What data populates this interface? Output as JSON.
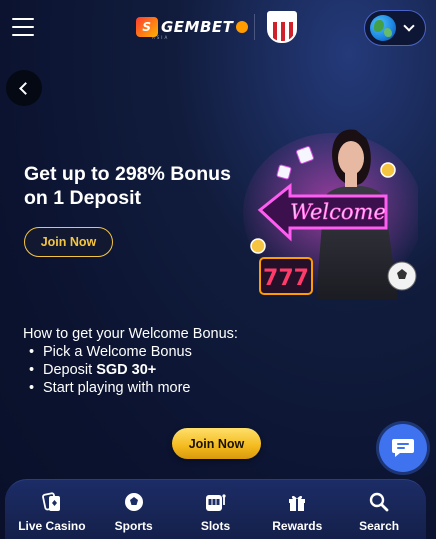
{
  "header": {
    "logo_text": "GEMBET",
    "logo_tagline": "ASIA"
  },
  "hero": {
    "title": "Get up to 298% Bonus on 1 Deposit",
    "join_label": "Join Now",
    "promo_sign_text": "Welcome",
    "slot_reels": "777"
  },
  "howto": {
    "heading": "How to get your Welcome Bonus:",
    "steps": [
      {
        "text": "Pick a Welcome Bonus"
      },
      {
        "prefix": "Deposit ",
        "bold": "SGD 30+"
      },
      {
        "text": "Start playing with more"
      }
    ]
  },
  "cta": {
    "join_label": "Join Now"
  },
  "bottom_nav": {
    "items": [
      {
        "label": "Live Casino",
        "icon": "cards-icon"
      },
      {
        "label": "Sports",
        "icon": "soccer-ball-icon"
      },
      {
        "label": "Slots",
        "icon": "slot-machine-icon"
      },
      {
        "label": "Rewards",
        "icon": "gift-icon"
      },
      {
        "label": "Search",
        "icon": "search-icon"
      }
    ]
  },
  "colors": {
    "accent_gold": "#f5c542",
    "chat_blue": "#3f72ef",
    "nav_bg": "#1c2c66"
  }
}
